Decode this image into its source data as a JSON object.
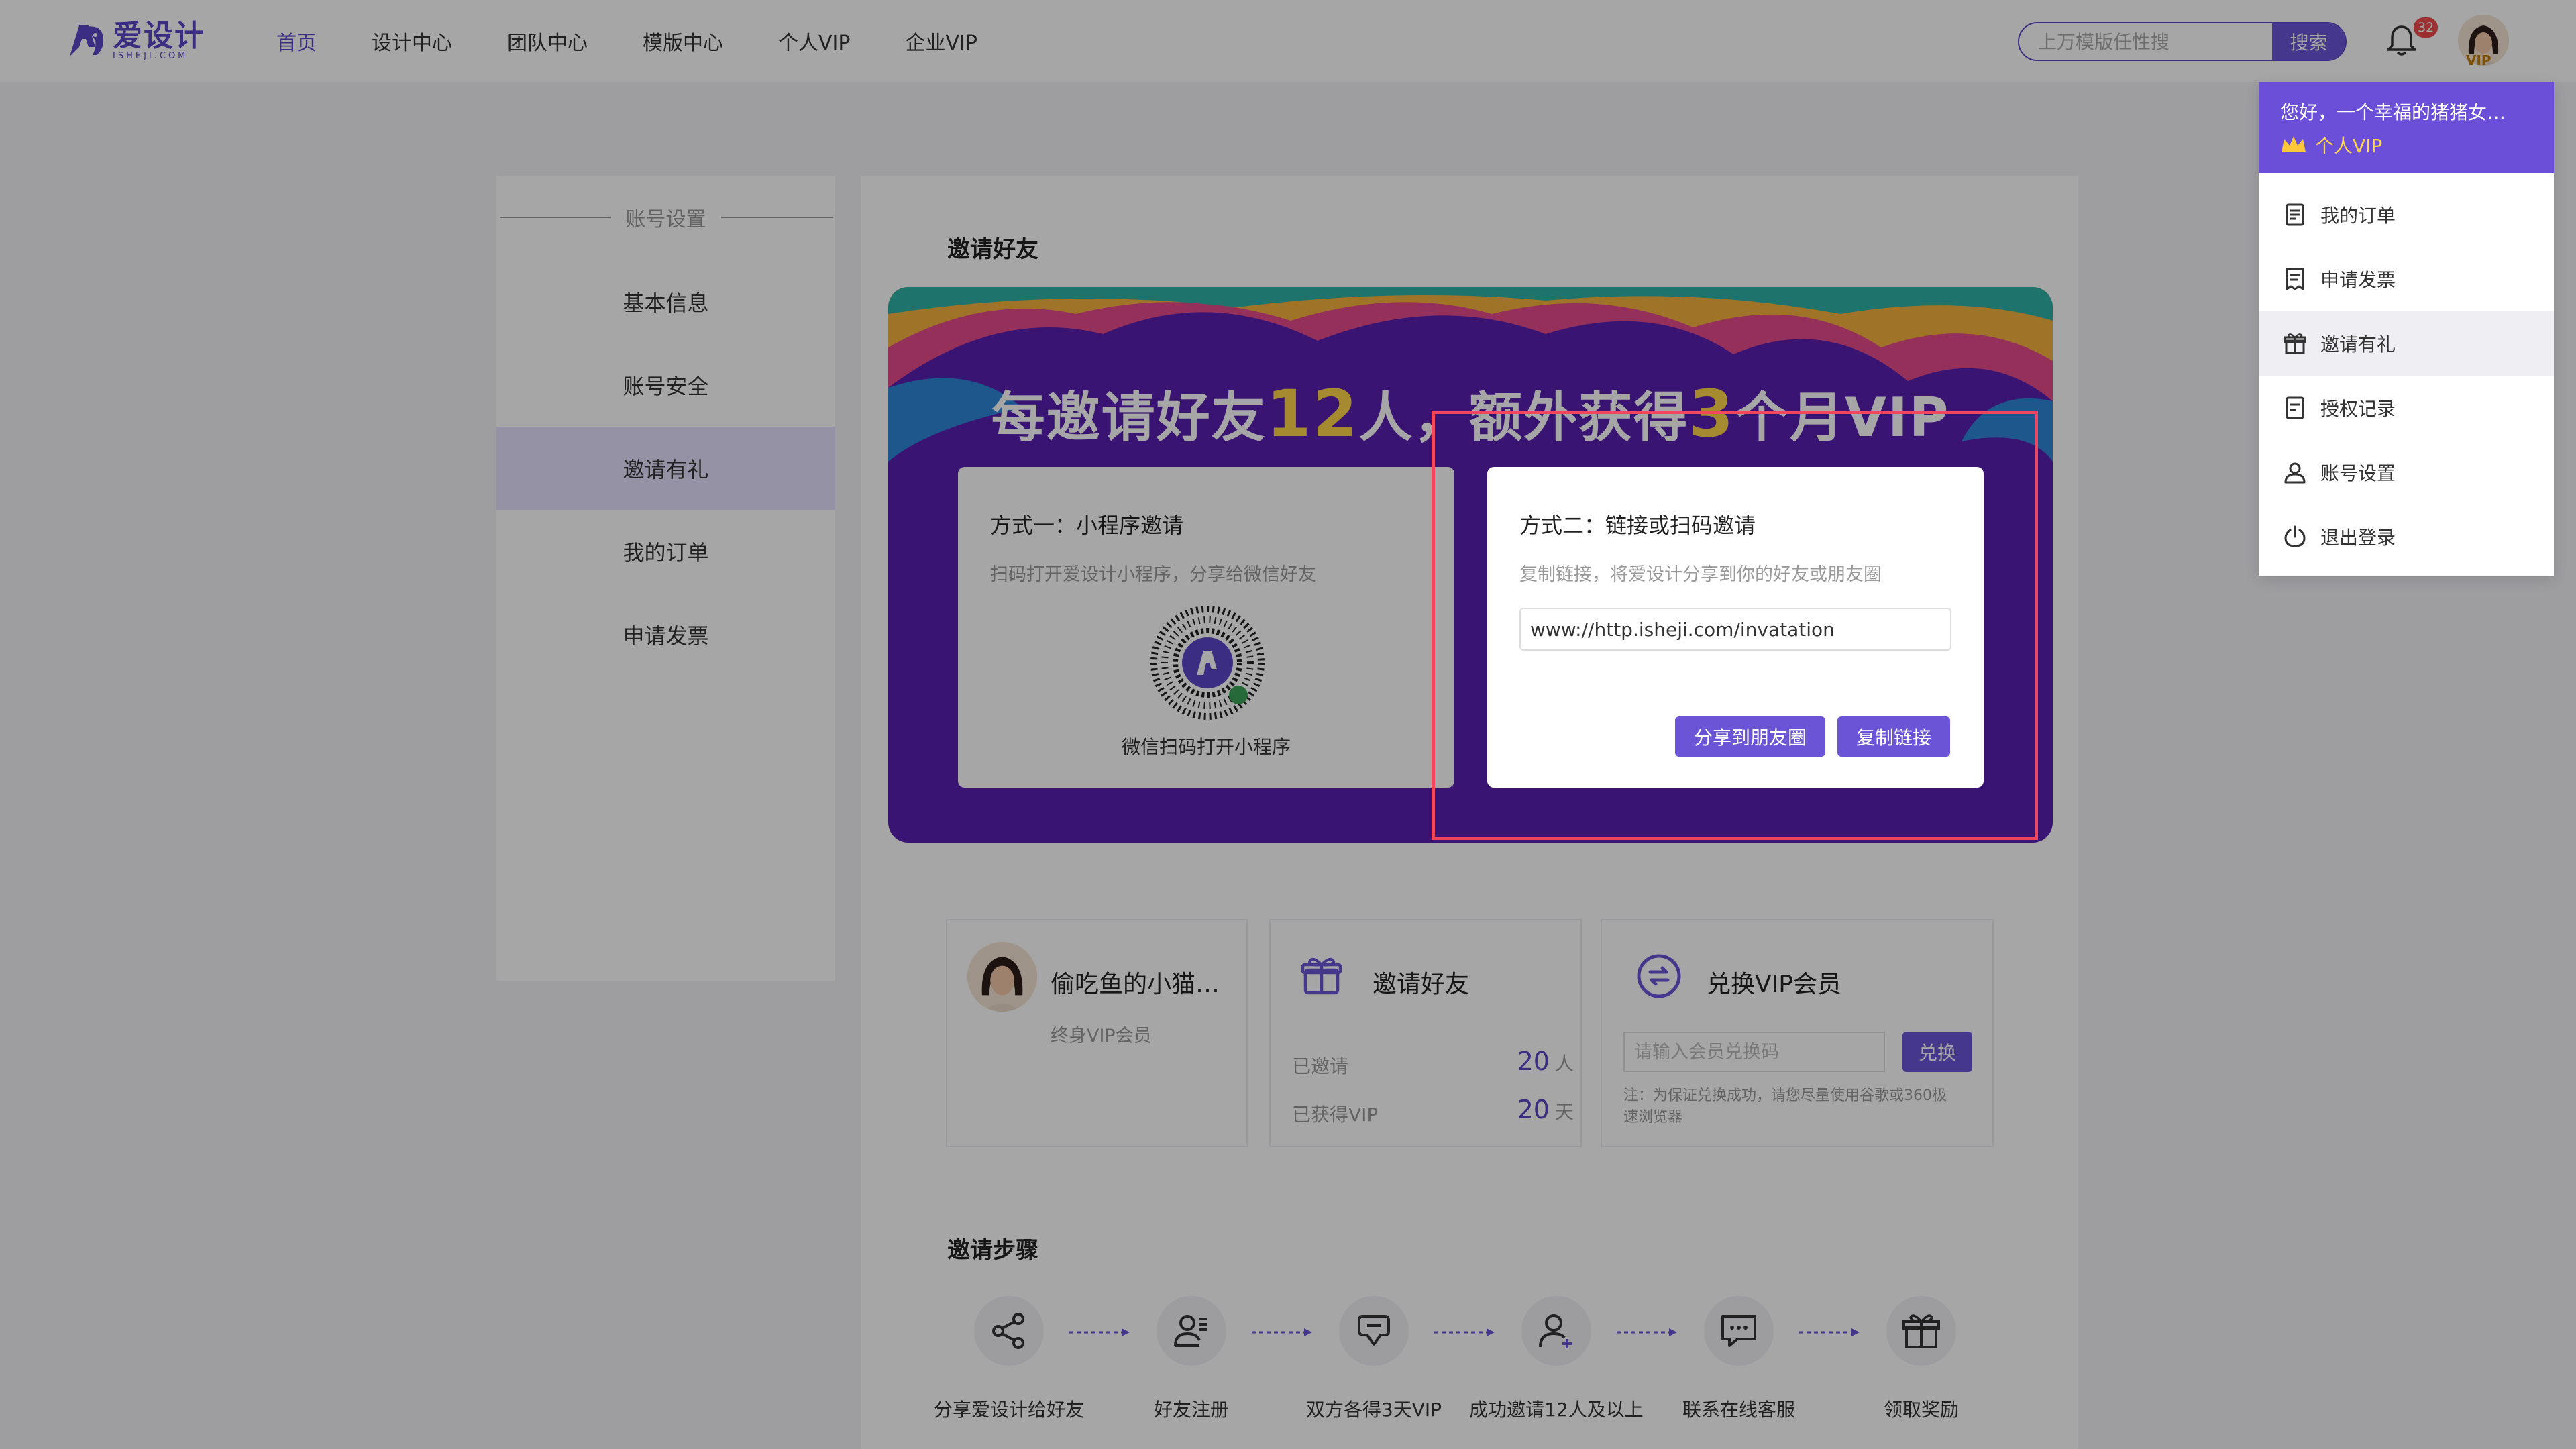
{
  "header": {
    "logo_cn": "爱设计",
    "logo_en": "ISHEJI.COM",
    "nav": [
      "首页",
      "设计中心",
      "团队中心",
      "模版中心",
      "个人VIP",
      "企业VIP"
    ],
    "search_placeholder": "上万模版任性搜",
    "search_button": "搜索",
    "notification_count": "32",
    "avatar_badge": "VIP"
  },
  "sidebar": {
    "heading": "账号设置",
    "items": [
      "基本信息",
      "账号安全",
      "邀请有礼",
      "我的订单",
      "申请发票"
    ],
    "active_index": 2
  },
  "invite": {
    "section_title": "邀请好友",
    "banner": {
      "text_a": "每邀请好友",
      "num_a": "12",
      "text_b": "人，额外获得",
      "num_b": "3",
      "text_c": "个月VIP"
    },
    "way1": {
      "title": "方式一：小程序邀请",
      "desc": "扫码打开爱设计小程序，分享给微信好友",
      "caption": "微信扫码打开小程序"
    },
    "way2": {
      "title": "方式二：链接或扫码邀请",
      "desc": "复制链接，将爱设计分享到你的好友或朋友圈",
      "link": "www://http.isheji.com/invatation",
      "share_button": "分享到朋友圈",
      "copy_button": "复制链接"
    }
  },
  "cards": {
    "user": {
      "name": "偷吃鱼的小猫…",
      "level": "终身VIP会员"
    },
    "friends": {
      "title": "邀请好友",
      "invited_label": "已邀请",
      "invited_value": "20",
      "invited_unit": "人",
      "vip_label": "已获得VIP",
      "vip_value": "20",
      "vip_unit": "天"
    },
    "redeem": {
      "title": "兑换VIP会员",
      "placeholder": "请输入会员兑换码",
      "button": "兑换",
      "note": "注：为保证兑换成功，请您尽量使用谷歌或360极速浏览器"
    }
  },
  "steps": {
    "title": "邀请步骤",
    "items": [
      "分享爱设计给好友",
      "好友注册",
      "双方各得3天VIP",
      "成功邀请12人及以上",
      "联系在线客服",
      "领取奖励"
    ]
  },
  "dropdown": {
    "greeting": "您好，一个幸福的猪猪女…",
    "vip": "个人VIP",
    "items": [
      "我的订单",
      "申请发票",
      "邀请有礼",
      "授权记录",
      "账号设置",
      "退出登录"
    ],
    "active_index": 2
  },
  "colors": {
    "accent": "#6b55d6",
    "banner_bg": "#5a1fb1",
    "highlight": "#f0465e",
    "number": "#ffd54a"
  }
}
